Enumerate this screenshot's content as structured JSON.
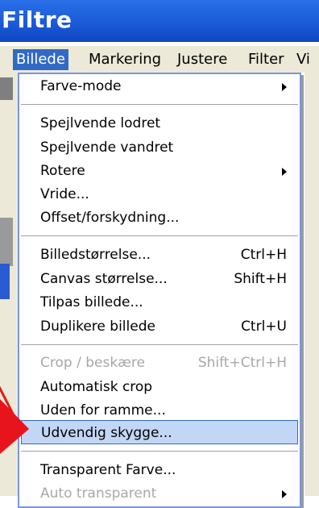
{
  "window": {
    "title": "Filtre"
  },
  "menubar": {
    "items": [
      {
        "label": "Billede",
        "active": true
      },
      {
        "label": "Markering"
      },
      {
        "label": "Justere"
      },
      {
        "label": "Filter"
      },
      {
        "label": "Vi"
      }
    ]
  },
  "menu": {
    "farve_mode": {
      "label": "Farve-mode"
    },
    "spejl_lodret": {
      "label": "Spejlvende lodret"
    },
    "spejl_vandret": {
      "label": "Spejlvende vandret"
    },
    "rotere": {
      "label": "Rotere"
    },
    "vride": {
      "label": "Vride..."
    },
    "offset": {
      "label": "Offset/forskydning..."
    },
    "billedstorrelse": {
      "label": "Billedstørrelse...",
      "shortcut": "Ctrl+H"
    },
    "canvas": {
      "label": "Canvas størrelse...",
      "shortcut": "Shift+H"
    },
    "tilpas": {
      "label": "Tilpas billede..."
    },
    "duplikere": {
      "label": "Duplikere billede",
      "shortcut": "Ctrl+U"
    },
    "crop": {
      "label": "Crop / beskære",
      "shortcut": "Shift+Ctrl+H",
      "disabled": true
    },
    "autocrop": {
      "label": "Automatisk crop"
    },
    "uden_ramme": {
      "label": "Uden for ramme..."
    },
    "udvendig": {
      "label": "Udvendig skygge...",
      "highlighted": true
    },
    "transparent": {
      "label": "Transparent Farve..."
    },
    "auto_transparent": {
      "label": "Auto transparent",
      "disabled": true
    }
  },
  "colors": {
    "titlebar": "#1b5ad8",
    "menu_highlight": "#c2d6f5",
    "active_menu": "#316ac5",
    "annotation_arrow": "#e8141c"
  },
  "icons": [
    "submenu-arrow-icon",
    "red-pointer-arrow-icon"
  ]
}
